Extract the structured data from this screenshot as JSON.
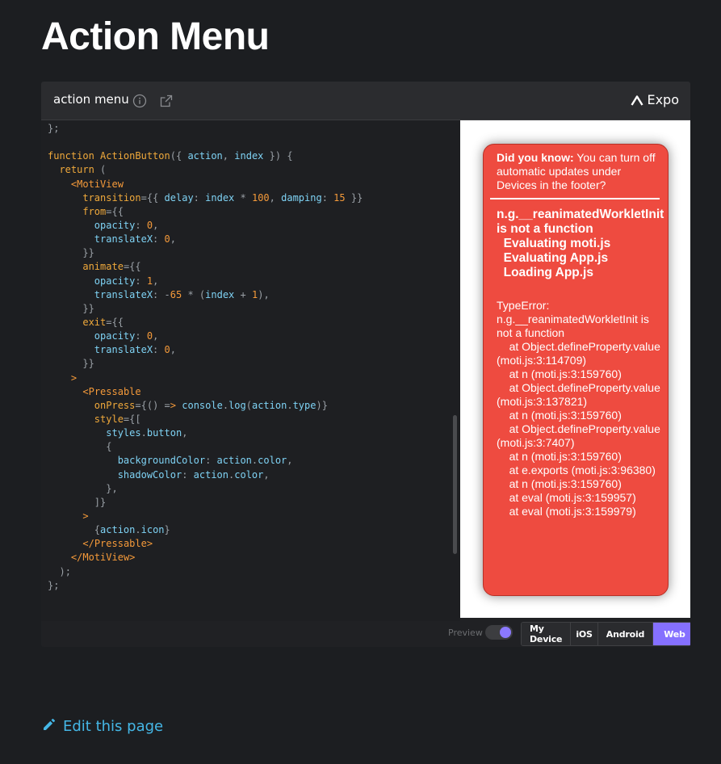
{
  "page": {
    "title": "Action Menu"
  },
  "snack": {
    "title": "action menu",
    "info_icon": "info-icon",
    "open_icon": "external-link-icon",
    "brand": "Expo"
  },
  "editor": {
    "code_lines": [
      "};",
      "",
      "function ActionButton({ action, index }) {",
      "  return (",
      "    <MotiView",
      "      transition={{ delay: index * 100, damping: 15 }}",
      "      from={{",
      "        opacity: 0,",
      "        translateX: 0,",
      "      }}",
      "      animate={{",
      "        opacity: 1,",
      "        translateX: -65 * (index + 1),",
      "      }}",
      "      exit={{",
      "        opacity: 0,",
      "        translateX: 0,",
      "      }}",
      "    >",
      "      <Pressable",
      "        onPress={() => console.log(action.type)}",
      "        style={[",
      "          styles.button,",
      "          {",
      "            backgroundColor: action.color,",
      "            shadowColor: action.color,",
      "          },",
      "        ]}",
      "      >",
      "        {action.icon}",
      "      </Pressable>",
      "    </MotiView>",
      "  );",
      "};"
    ]
  },
  "preview": {
    "tip_bold": "Did you know:",
    "tip_text": " You can turn off automatic updates under Devices in the footer?",
    "error_title": "n.g.__reanimatedWorkletInit is not a function\n  Evaluating moti.js\n  Evaluating App.js\n  Loading App.js",
    "stack_trace": "TypeError: n.g.__reanimatedWorkletInit is not a function\n    at Object.defineProperty.value (moti.js:3:114709)\n    at n (moti.js:3:159760)\n    at Object.defineProperty.value (moti.js:3:137821)\n    at n (moti.js:3:159760)\n    at Object.defineProperty.value (moti.js:3:7407)\n    at n (moti.js:3:159760)\n    at e.exports (moti.js:3:96380)\n    at n (moti.js:3:159760)\n    at eval (moti.js:3:159957)\n    at eval (moti.js:3:159979)"
  },
  "footer": {
    "preview_label": "Preview",
    "preview_enabled": true,
    "platforms": [
      "My Device",
      "iOS",
      "Android",
      "Web"
    ],
    "active_platform": "Web"
  },
  "edit_link": {
    "label": "Edit this page"
  },
  "colors": {
    "background": "#1c1e21",
    "error_red": "#ee4b40",
    "accent_purple": "#8570ff",
    "link_blue": "#45b7e6"
  }
}
